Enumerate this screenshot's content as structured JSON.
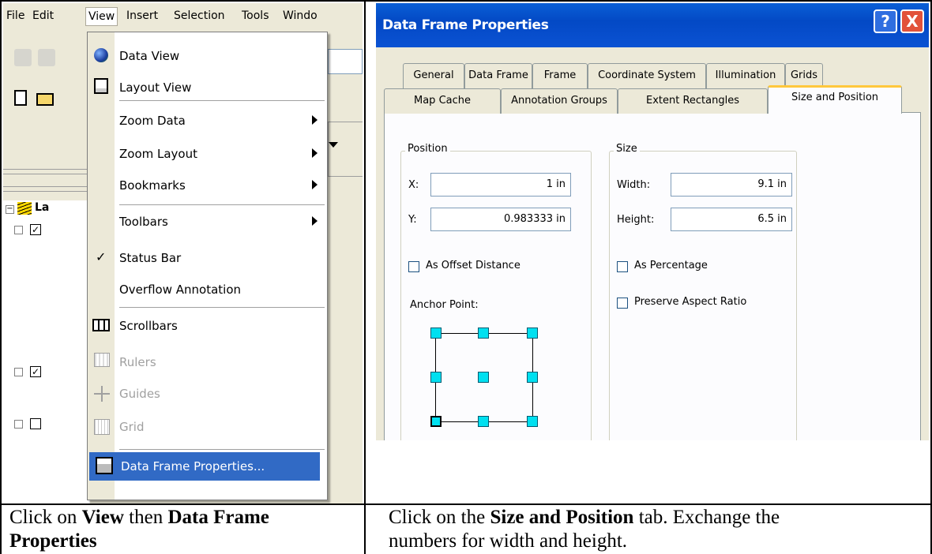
{
  "left": {
    "menubar": [
      "File",
      "Edit",
      "View",
      "Insert",
      "Selection",
      "Tools",
      "Windo"
    ],
    "toc_label": "La",
    "menu_items": [
      {
        "label": "Data View",
        "icon": "globe-icon",
        "submenu": false,
        "disabled": false
      },
      {
        "label": "Layout View",
        "icon": "layout-page-icon",
        "submenu": false,
        "disabled": false
      },
      {
        "label": "Zoom Data",
        "icon": "",
        "submenu": true,
        "disabled": false
      },
      {
        "label": "Zoom Layout",
        "icon": "",
        "submenu": true,
        "disabled": false
      },
      {
        "label": "Bookmarks",
        "icon": "",
        "submenu": true,
        "disabled": false
      },
      {
        "label": "Toolbars",
        "icon": "",
        "submenu": true,
        "disabled": false
      },
      {
        "label": "Status Bar",
        "icon": "checkmark-icon",
        "submenu": false,
        "disabled": false
      },
      {
        "label": "Overflow Annotation",
        "icon": "",
        "submenu": false,
        "disabled": false
      },
      {
        "label": "Scrollbars",
        "icon": "scrollbars-icon",
        "submenu": false,
        "disabled": false
      },
      {
        "label": "Rulers",
        "icon": "rulers-icon",
        "submenu": false,
        "disabled": true
      },
      {
        "label": "Guides",
        "icon": "guides-icon",
        "submenu": false,
        "disabled": true
      },
      {
        "label": "Grid",
        "icon": "grid-icon",
        "submenu": false,
        "disabled": true
      },
      {
        "label": "Data Frame Properties...",
        "icon": "properties-icon",
        "submenu": false,
        "disabled": false,
        "highlighted": true
      }
    ],
    "caption": {
      "p1": "Click on ",
      "b1": "View",
      "p2": " then ",
      "b2": "Data Frame",
      "b3": "Properties"
    }
  },
  "right": {
    "dialog_title": "Data Frame Properties",
    "help_glyph": "?",
    "close_glyph": "X",
    "tabs_row1": [
      "General",
      "Data Frame",
      "Frame",
      "Coordinate System",
      "Illumination",
      "Grids"
    ],
    "tabs_row2": [
      "Map Cache",
      "Annotation Groups",
      "Extent Rectangles",
      "Size and Position"
    ],
    "position": {
      "group_label": "Position",
      "x_label": "X:",
      "x_value": "1 in",
      "y_label": "Y:",
      "y_value": "0.983333 in",
      "offset_label": "As Offset Distance",
      "anchor_label": "Anchor Point:"
    },
    "size": {
      "group_label": "Size",
      "width_label": "Width:",
      "width_value": "9.1 in",
      "height_label": "Height:",
      "height_value": "6.5 in",
      "percentage_label": "As Percentage",
      "aspect_label": "Preserve Aspect Ratio"
    },
    "caption": {
      "p1": "Click on the ",
      "b1": "Size and Position",
      "p2": " tab.  Exchange the",
      "line2": "numbers for width and height."
    }
  }
}
